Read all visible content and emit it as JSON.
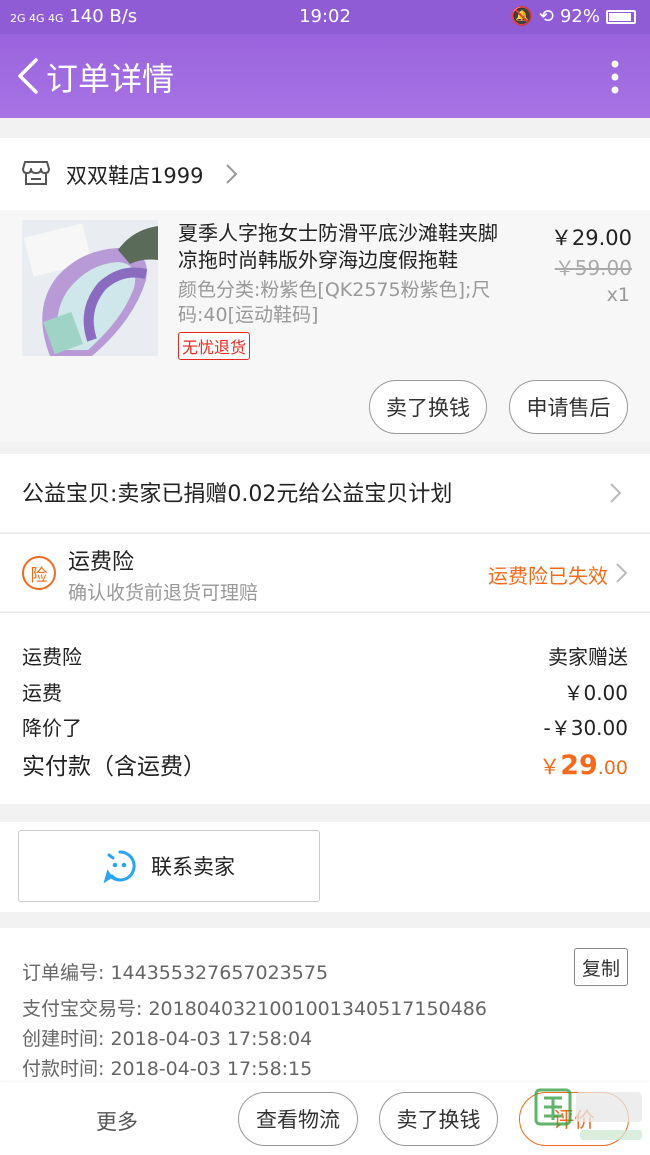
{
  "status_bar": {
    "network": "2G 4G 4G",
    "speed": "140 B/s",
    "time": "19:02",
    "battery": "92%"
  },
  "header": {
    "title": "订单详情"
  },
  "shop": {
    "name": "双双鞋店1999"
  },
  "item": {
    "title": "夏季人字拖女士防滑平底沙滩鞋夹脚凉拖时尚韩版外穿海边度假拖鞋",
    "spec": "颜色分类:粉紫色[QK2575粉紫色];尺码:40[运动鞋码]",
    "badge": "无忧退货",
    "price": "￥29.00",
    "original_price": "￥59.00",
    "quantity": "x1",
    "sell_label": "卖了换钱",
    "aftersale_label": "申请售后"
  },
  "charity": {
    "text": "公益宝贝:卖家已捐赠0.02元给公益宝贝计划"
  },
  "insurance": {
    "icon_text": "险",
    "title": "运费险",
    "subtitle": "确认收货前退货可理赔",
    "status": "运费险已失效"
  },
  "costs": {
    "rows": [
      {
        "label": "运费险",
        "value": "卖家赠送"
      },
      {
        "label": "运费",
        "value": "￥0.00"
      },
      {
        "label": "降价了",
        "value": "-￥30.00"
      }
    ],
    "total_label": "实付款（含运费）",
    "total_currency": "￥",
    "total_int": "29",
    "total_dec": ".00"
  },
  "contact": {
    "label": "联系卖家"
  },
  "order_info": {
    "order_no": "订单编号: 144355327657023575",
    "copy_label": "复制",
    "alipay_no": "支付宝交易号: 2018040321001001340517150486",
    "created": "创建时间: 2018-04-03 17:58:04",
    "paid": "付款时间: 2018-04-03 17:58:15"
  },
  "bottom_bar": {
    "more_label": "更多",
    "logistics_label": "查看物流",
    "sell_label": "卖了换钱",
    "review_label": "评价"
  },
  "colors": {
    "header": "#9b63dd",
    "accent": "#f26b1d",
    "badge_red": "#e8271d",
    "wangwang_blue": "#2aa6f0"
  }
}
